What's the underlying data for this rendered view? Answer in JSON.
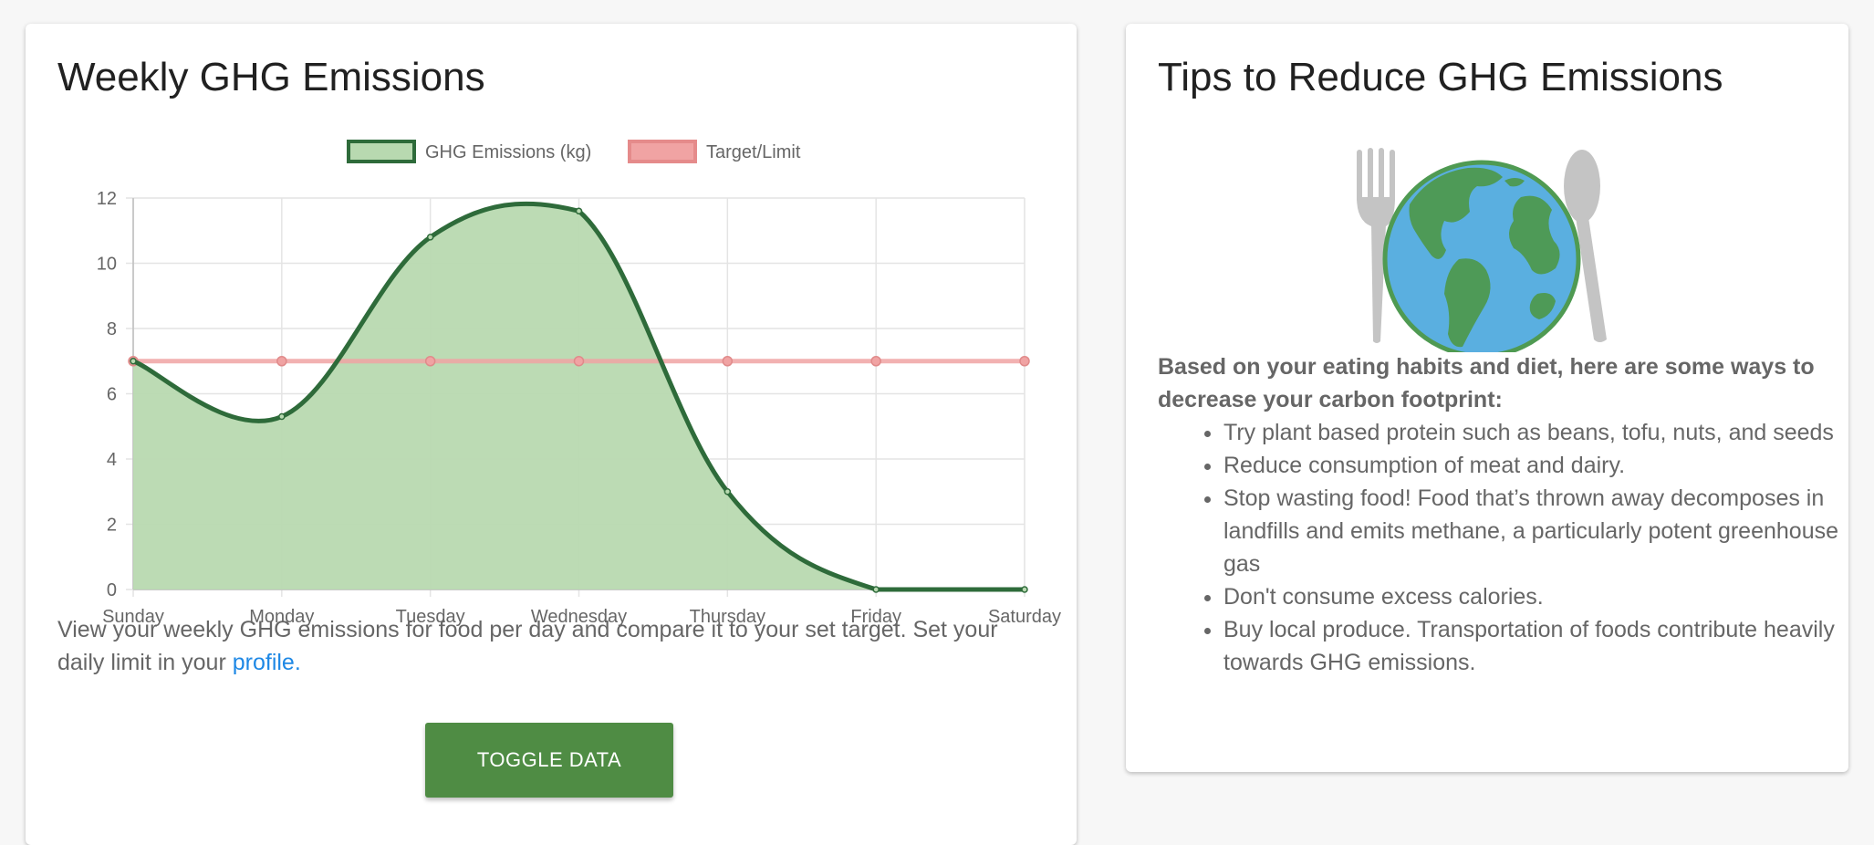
{
  "emissions_card": {
    "title": "Weekly GHG Emissions",
    "description_text": "View your weekly GHG emissions for food per day and compare it to your set target. Set your daily limit in your ",
    "profile_link": "profile.",
    "toggle_button": "TOGGLE DATA"
  },
  "tips_card": {
    "title": "Tips to Reduce GHG Emissions",
    "intro": "Based on your eating habits and diet, here are some ways to decrease your carbon footprint:",
    "tips": [
      "Try plant based protein such as beans, tofu, nuts, and seeds",
      "Reduce consumption of meat and dairy.",
      "Stop wasting food! Food that’s thrown away decomposes in landfills and emits methane, a particularly potent greenhouse gas",
      "Don't consume excess calories.",
      "Buy local produce. Transportation of foods contribute heavily towards GHG emissions."
    ],
    "image_icon": "globe-with-fork-and-spoon-icon"
  },
  "chart_data": {
    "type": "area",
    "categories": [
      "Sunday",
      "Monday",
      "Tuesday",
      "Wednesday",
      "Thursday",
      "Friday",
      "Saturday"
    ],
    "series": [
      {
        "name": "GHG Emissions (kg)",
        "values": [
          7.0,
          5.3,
          10.8,
          11.6,
          3.0,
          0,
          0
        ],
        "color": "#2e6b3a",
        "fill": "#b8d9b0"
      },
      {
        "name": "Target/Limit",
        "values": [
          7,
          7,
          7,
          7,
          7,
          7,
          7
        ],
        "color": "#f0a3a3",
        "fill": "#f0a3a3"
      }
    ],
    "ylim": [
      0,
      12
    ],
    "yticks": [
      0,
      2,
      4,
      6,
      8,
      10,
      12
    ],
    "grid": true,
    "legend": "top-center"
  }
}
